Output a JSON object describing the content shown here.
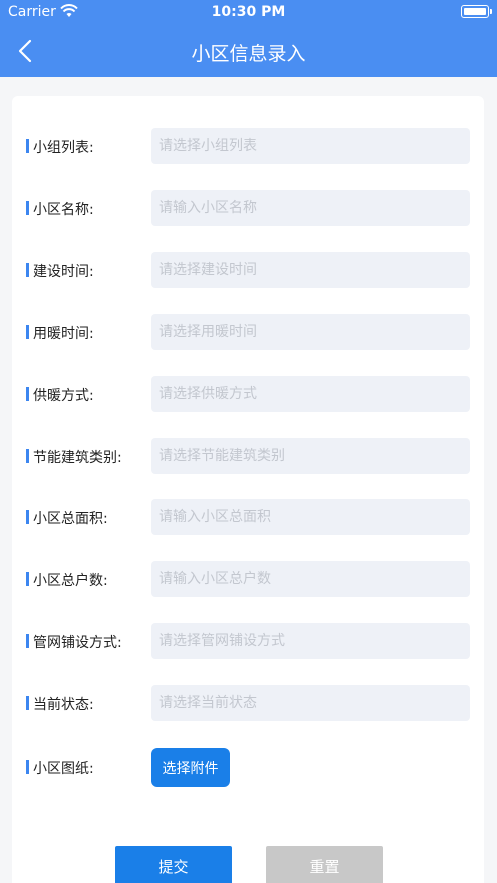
{
  "status_bar": {
    "carrier": "Carrier",
    "time": "10:30 PM",
    "icons": [
      "wifi-icon",
      "battery-icon"
    ]
  },
  "nav": {
    "title": "小区信息录入",
    "back_icon": "chevron-left-icon"
  },
  "colors": {
    "header": "#4a8ef2",
    "accent": "#1a7fe8",
    "label_marker": "#3c86f0",
    "field_bg": "#eef1f7",
    "reset_bg": "#c8c8c8"
  },
  "form": {
    "fields": [
      {
        "label": "小组列表:",
        "placeholder": "请选择小组列表"
      },
      {
        "label": "小区名称:",
        "placeholder": "请输入小区名称"
      },
      {
        "label": "建设时间:",
        "placeholder": "请选择建设时间"
      },
      {
        "label": "用暖时间:",
        "placeholder": "请选择用暖时间"
      },
      {
        "label": "供暖方式:",
        "placeholder": "请选择供暖方式"
      },
      {
        "label": "节能建筑类别:",
        "placeholder": "请选择节能建筑类别"
      },
      {
        "label": "小区总面积:",
        "placeholder": "请输入小区总面积"
      },
      {
        "label": "小区总户数:",
        "placeholder": "请输入小区总户数"
      },
      {
        "label": "管网铺设方式:",
        "placeholder": "请选择管网铺设方式"
      },
      {
        "label": "当前状态:",
        "placeholder": "请选择当前状态"
      }
    ],
    "attachment": {
      "label": "小区图纸:",
      "button_label": "选择附件"
    }
  },
  "actions": {
    "submit_label": "提交",
    "reset_label": "重置"
  }
}
